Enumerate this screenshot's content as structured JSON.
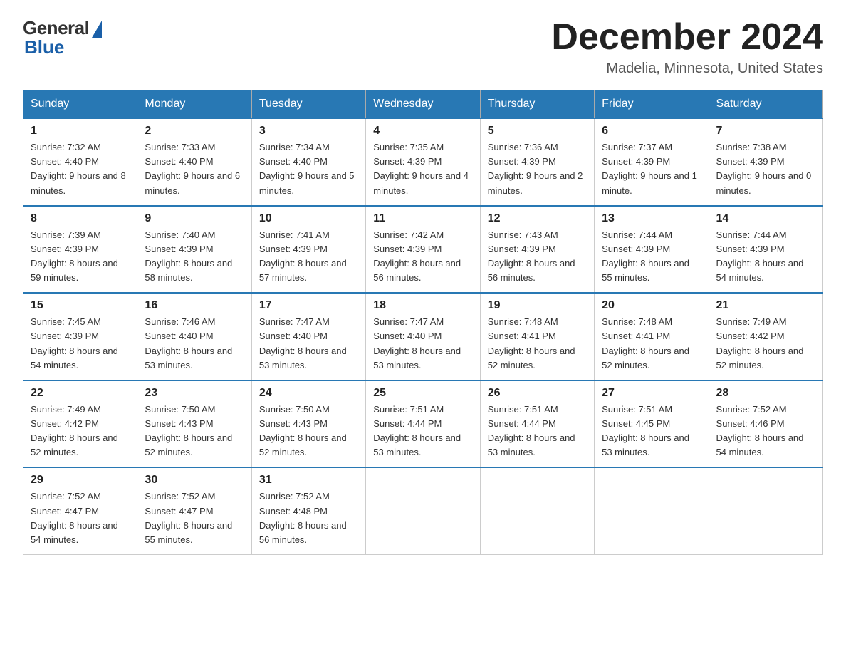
{
  "logo": {
    "general": "General",
    "blue": "Blue"
  },
  "title": "December 2024",
  "location": "Madelia, Minnesota, United States",
  "days_of_week": [
    "Sunday",
    "Monday",
    "Tuesday",
    "Wednesday",
    "Thursday",
    "Friday",
    "Saturday"
  ],
  "weeks": [
    [
      {
        "day": "1",
        "sunrise": "7:32 AM",
        "sunset": "4:40 PM",
        "daylight": "9 hours and 8 minutes."
      },
      {
        "day": "2",
        "sunrise": "7:33 AM",
        "sunset": "4:40 PM",
        "daylight": "9 hours and 6 minutes."
      },
      {
        "day": "3",
        "sunrise": "7:34 AM",
        "sunset": "4:40 PM",
        "daylight": "9 hours and 5 minutes."
      },
      {
        "day": "4",
        "sunrise": "7:35 AM",
        "sunset": "4:39 PM",
        "daylight": "9 hours and 4 minutes."
      },
      {
        "day": "5",
        "sunrise": "7:36 AM",
        "sunset": "4:39 PM",
        "daylight": "9 hours and 2 minutes."
      },
      {
        "day": "6",
        "sunrise": "7:37 AM",
        "sunset": "4:39 PM",
        "daylight": "9 hours and 1 minute."
      },
      {
        "day": "7",
        "sunrise": "7:38 AM",
        "sunset": "4:39 PM",
        "daylight": "9 hours and 0 minutes."
      }
    ],
    [
      {
        "day": "8",
        "sunrise": "7:39 AM",
        "sunset": "4:39 PM",
        "daylight": "8 hours and 59 minutes."
      },
      {
        "day": "9",
        "sunrise": "7:40 AM",
        "sunset": "4:39 PM",
        "daylight": "8 hours and 58 minutes."
      },
      {
        "day": "10",
        "sunrise": "7:41 AM",
        "sunset": "4:39 PM",
        "daylight": "8 hours and 57 minutes."
      },
      {
        "day": "11",
        "sunrise": "7:42 AM",
        "sunset": "4:39 PM",
        "daylight": "8 hours and 56 minutes."
      },
      {
        "day": "12",
        "sunrise": "7:43 AM",
        "sunset": "4:39 PM",
        "daylight": "8 hours and 56 minutes."
      },
      {
        "day": "13",
        "sunrise": "7:44 AM",
        "sunset": "4:39 PM",
        "daylight": "8 hours and 55 minutes."
      },
      {
        "day": "14",
        "sunrise": "7:44 AM",
        "sunset": "4:39 PM",
        "daylight": "8 hours and 54 minutes."
      }
    ],
    [
      {
        "day": "15",
        "sunrise": "7:45 AM",
        "sunset": "4:39 PM",
        "daylight": "8 hours and 54 minutes."
      },
      {
        "day": "16",
        "sunrise": "7:46 AM",
        "sunset": "4:40 PM",
        "daylight": "8 hours and 53 minutes."
      },
      {
        "day": "17",
        "sunrise": "7:47 AM",
        "sunset": "4:40 PM",
        "daylight": "8 hours and 53 minutes."
      },
      {
        "day": "18",
        "sunrise": "7:47 AM",
        "sunset": "4:40 PM",
        "daylight": "8 hours and 53 minutes."
      },
      {
        "day": "19",
        "sunrise": "7:48 AM",
        "sunset": "4:41 PM",
        "daylight": "8 hours and 52 minutes."
      },
      {
        "day": "20",
        "sunrise": "7:48 AM",
        "sunset": "4:41 PM",
        "daylight": "8 hours and 52 minutes."
      },
      {
        "day": "21",
        "sunrise": "7:49 AM",
        "sunset": "4:42 PM",
        "daylight": "8 hours and 52 minutes."
      }
    ],
    [
      {
        "day": "22",
        "sunrise": "7:49 AM",
        "sunset": "4:42 PM",
        "daylight": "8 hours and 52 minutes."
      },
      {
        "day": "23",
        "sunrise": "7:50 AM",
        "sunset": "4:43 PM",
        "daylight": "8 hours and 52 minutes."
      },
      {
        "day": "24",
        "sunrise": "7:50 AM",
        "sunset": "4:43 PM",
        "daylight": "8 hours and 52 minutes."
      },
      {
        "day": "25",
        "sunrise": "7:51 AM",
        "sunset": "4:44 PM",
        "daylight": "8 hours and 53 minutes."
      },
      {
        "day": "26",
        "sunrise": "7:51 AM",
        "sunset": "4:44 PM",
        "daylight": "8 hours and 53 minutes."
      },
      {
        "day": "27",
        "sunrise": "7:51 AM",
        "sunset": "4:45 PM",
        "daylight": "8 hours and 53 minutes."
      },
      {
        "day": "28",
        "sunrise": "7:52 AM",
        "sunset": "4:46 PM",
        "daylight": "8 hours and 54 minutes."
      }
    ],
    [
      {
        "day": "29",
        "sunrise": "7:52 AM",
        "sunset": "4:47 PM",
        "daylight": "8 hours and 54 minutes."
      },
      {
        "day": "30",
        "sunrise": "7:52 AM",
        "sunset": "4:47 PM",
        "daylight": "8 hours and 55 minutes."
      },
      {
        "day": "31",
        "sunrise": "7:52 AM",
        "sunset": "4:48 PM",
        "daylight": "8 hours and 56 minutes."
      },
      null,
      null,
      null,
      null
    ]
  ]
}
